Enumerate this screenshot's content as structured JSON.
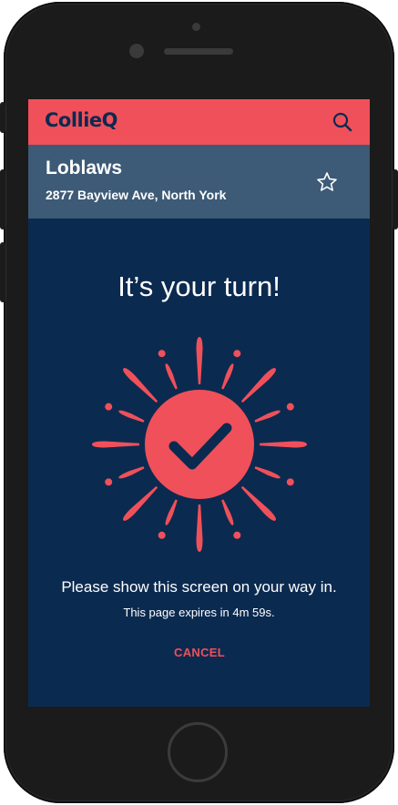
{
  "app": {
    "logo_text": "CollieQ",
    "search_icon": "search-icon"
  },
  "store": {
    "name": "Loblaws",
    "address": "2877 Bayview Ave, North York",
    "favorite_icon": "star-outline-icon"
  },
  "turn": {
    "headline": "It’s your turn!",
    "status_icon": "checkmark-burst-icon",
    "instruction": "Please show this screen on your way in.",
    "expiry": "This page expires in 4m 59s.",
    "cancel_label": "CANCEL"
  },
  "colors": {
    "accent": "#f0505a",
    "navy": "#0b2a50",
    "store_bar": "#3d5a76",
    "text": "#ffffff"
  }
}
